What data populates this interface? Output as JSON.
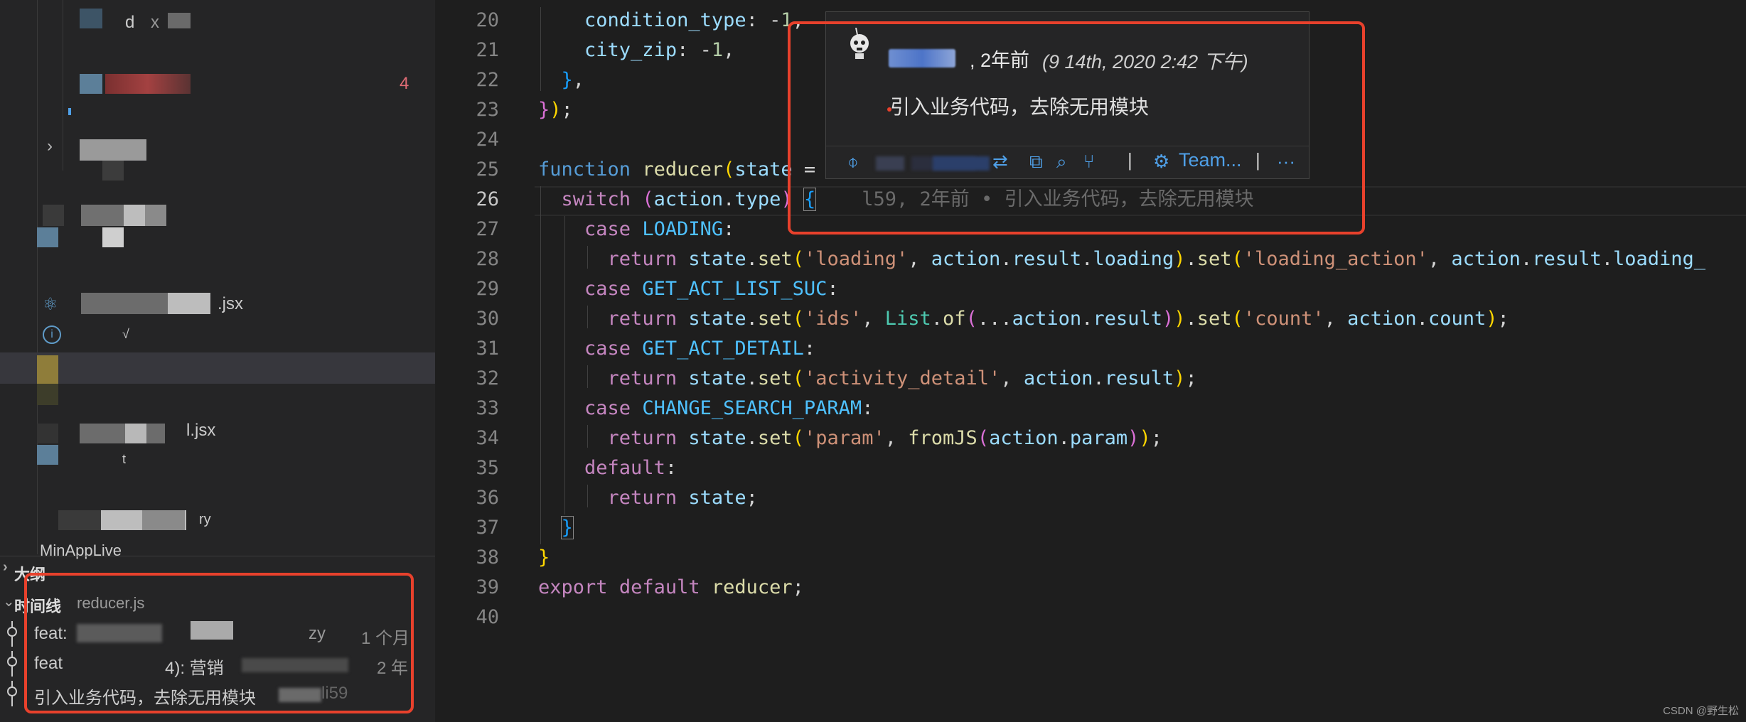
{
  "sidebar": {
    "items": [
      {
        "label": "d"
      },
      {
        "label": "x"
      },
      {
        "label": ".jsx"
      },
      {
        "label": "√"
      },
      {
        "label": "l.jsx"
      },
      {
        "label": "t"
      },
      {
        "label": "ry"
      },
      {
        "label": "MinAppLive"
      }
    ],
    "badge": "4",
    "outline_label": "大纲",
    "timeline_label": "时间线",
    "timeline_file": "reducer.js",
    "timeline": [
      {
        "message": "feat:",
        "suffix": "zy",
        "time": "1 个月"
      },
      {
        "message": "feat",
        "suffix": "4): 营销",
        "time": "2 年"
      },
      {
        "message": "引入业务代码，去除无用模块",
        "suffix": "li59",
        "time": ""
      }
    ]
  },
  "editor": {
    "ghost_text": "l59, 2年前 • 引入业务代码，去除无用模块",
    "line_numbers": [
      "20",
      "21",
      "22",
      "23",
      "24",
      "25",
      "26",
      "27",
      "28",
      "29",
      "30",
      "31",
      "32",
      "33",
      "34",
      "35",
      "36",
      "37",
      "38",
      "39",
      "40"
    ]
  },
  "hover": {
    "ago": ", 2年前",
    "date": "(9 14th, 2020 2:42 下午)",
    "message": "引入业务代码，去除无用模块",
    "team_label": "Team...",
    "separator": "|",
    "more": "···"
  },
  "watermark": "CSDN @野生松",
  "colors": {
    "accent_red": "#e8412c",
    "link_blue": "#4fa0e8"
  },
  "icons": [
    "commit-icon",
    "compare-icon",
    "copy-icon",
    "search-icon",
    "graph-icon",
    "gear-icon",
    "more-icon",
    "chevron-right-icon",
    "chevron-down-icon",
    "react-icon",
    "info-icon"
  ]
}
